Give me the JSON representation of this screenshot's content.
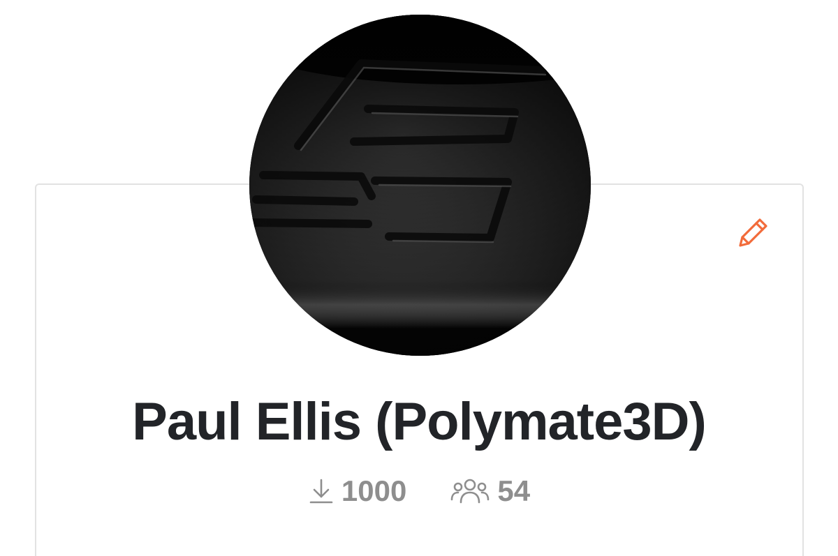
{
  "profile": {
    "name": "Paul Ellis (Polymate3D)",
    "avatar_icon": "polymate3d-logo",
    "edit_icon": "pencil-icon",
    "accent_color": "#f26b3a"
  },
  "stats": {
    "downloads": {
      "icon": "download-icon",
      "value": "1000"
    },
    "followers": {
      "icon": "users-icon",
      "value": "54"
    }
  }
}
